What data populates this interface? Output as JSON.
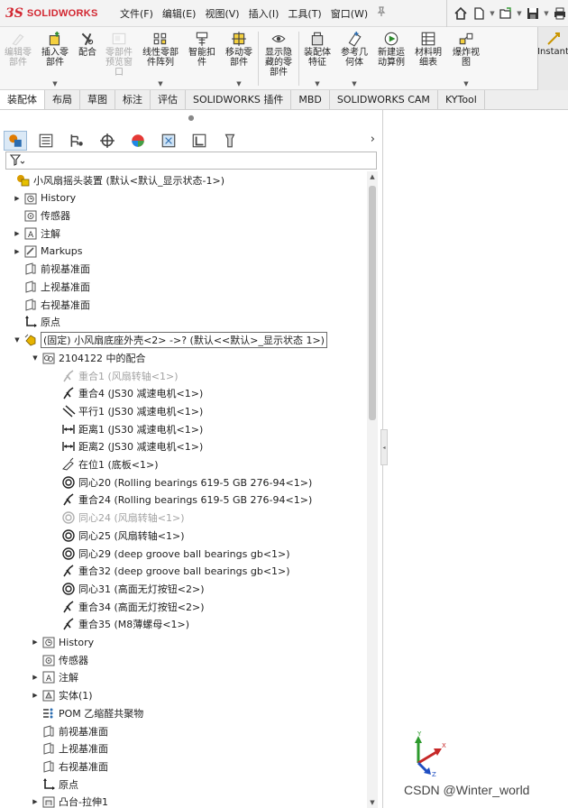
{
  "app": {
    "logo_mark": "3S",
    "logo_text": "SOLIDWORKS"
  },
  "menu": [
    "文件(F)",
    "编辑(E)",
    "视图(V)",
    "插入(I)",
    "工具(T)",
    "窗口(W)"
  ],
  "quick_access": [
    "home-icon",
    "new-document-icon",
    "open-folder-icon",
    "save-icon",
    "print-icon"
  ],
  "ribbon": {
    "buttons": [
      {
        "label": "编辑零\n部件",
        "icon": "edit-component-icon",
        "disabled": true
      },
      {
        "label": "插入零\n部件",
        "icon": "insert-component-icon",
        "disabled": false,
        "dropdown": true
      },
      {
        "label": "配合",
        "icon": "mate-icon",
        "disabled": false
      },
      {
        "label": "零部件\n预览窗\n口",
        "icon": "preview-window-icon",
        "disabled": true
      },
      {
        "label": "线性零部\n件阵列",
        "icon": "linear-pattern-icon",
        "disabled": false,
        "dropdown": true
      },
      {
        "label": "智能扣\n件",
        "icon": "smart-fastener-icon",
        "disabled": false
      },
      {
        "label": "移动零\n部件",
        "icon": "move-component-icon",
        "disabled": false,
        "dropdown": true
      },
      {
        "label": "显示隐\n藏的零\n部件",
        "icon": "show-hidden-icon",
        "disabled": false
      },
      {
        "label": "装配体\n特征",
        "icon": "assembly-feature-icon",
        "disabled": false,
        "dropdown": true
      },
      {
        "label": "参考几\n何体",
        "icon": "reference-geometry-icon",
        "disabled": false,
        "dropdown": true
      },
      {
        "label": "新建运\n动算例",
        "icon": "motion-study-icon",
        "disabled": false
      },
      {
        "label": "材料明\n细表",
        "icon": "bom-icon",
        "disabled": false
      },
      {
        "label": "爆炸视\n图",
        "icon": "exploded-view-icon",
        "disabled": false,
        "dropdown": true
      }
    ],
    "instant": "Instant"
  },
  "tabs": [
    "装配体",
    "布局",
    "草图",
    "标注",
    "评估",
    "SOLIDWORKS 插件",
    "MBD",
    "SOLIDWORKS CAM",
    "KYTool"
  ],
  "fm_tabs": [
    "feature-manager-icon",
    "property-manager-icon",
    "configuration-manager-icon",
    "dimxpert-icon",
    "display-manager-icon",
    "cam-feature-icon",
    "cam-operation-icon",
    "cam-tool-icon"
  ],
  "tree": [
    {
      "level": 0,
      "expander": "",
      "icon": "assembly-icon",
      "text": "小风扇摇头装置  (默认<默认_显示状态-1>)"
    },
    {
      "level": 1,
      "expander": "▶",
      "icon": "history-icon",
      "text": "History"
    },
    {
      "level": 1,
      "expander": "",
      "icon": "sensor-icon",
      "text": "传感器"
    },
    {
      "level": 1,
      "expander": "▶",
      "icon": "annotation-icon",
      "text": "注解"
    },
    {
      "level": 1,
      "expander": "▶",
      "icon": "markups-icon",
      "text": "Markups"
    },
    {
      "level": 1,
      "expander": "",
      "icon": "plane-icon",
      "text": "前视基准面"
    },
    {
      "level": 1,
      "expander": "",
      "icon": "plane-icon",
      "text": "上视基准面"
    },
    {
      "level": 1,
      "expander": "",
      "icon": "plane-icon",
      "text": "右视基准面"
    },
    {
      "level": 1,
      "expander": "",
      "icon": "origin-icon",
      "text": "原点"
    },
    {
      "level": 1,
      "expander": "▼",
      "icon": "part-icon",
      "text": "(固定) 小风扇底座外壳<2> ->? (默认<<默认>_显示状态 1>)",
      "selected": true
    },
    {
      "level": 2,
      "expander": "▼",
      "icon": "mates-folder-icon",
      "text": "2104122 中的配合"
    },
    {
      "level": 3,
      "expander": "",
      "icon": "coincident-mate-icon",
      "text": "重合1 (风扇转轴<1>)",
      "grey": true
    },
    {
      "level": 3,
      "expander": "",
      "icon": "coincident-mate-icon",
      "text": "重合4 (JS30 减速电机<1>)"
    },
    {
      "level": 3,
      "expander": "",
      "icon": "parallel-mate-icon",
      "text": "平行1 (JS30 减速电机<1>)"
    },
    {
      "level": 3,
      "expander": "",
      "icon": "distance-mate-icon",
      "text": "距离1 (JS30 减速电机<1>)"
    },
    {
      "level": 3,
      "expander": "",
      "icon": "distance-mate-icon",
      "text": "距离2 (JS30 减速电机<1>)"
    },
    {
      "level": 3,
      "expander": "",
      "icon": "lock-mate-icon",
      "text": "在位1 (底板<1>)"
    },
    {
      "level": 3,
      "expander": "",
      "icon": "concentric-mate-icon",
      "text": "同心20 (Rolling bearings 619-5 GB 276-94<1>)"
    },
    {
      "level": 3,
      "expander": "",
      "icon": "coincident-mate-icon",
      "text": "重合24 (Rolling bearings 619-5 GB 276-94<1>)"
    },
    {
      "level": 3,
      "expander": "",
      "icon": "concentric-mate-icon",
      "text": "同心24 (风扇转轴<1>)",
      "grey": true
    },
    {
      "level": 3,
      "expander": "",
      "icon": "concentric-mate-icon",
      "text": "同心25 (风扇转轴<1>)"
    },
    {
      "level": 3,
      "expander": "",
      "icon": "concentric-mate-icon",
      "text": "同心29 (deep groove ball bearings gb<1>)"
    },
    {
      "level": 3,
      "expander": "",
      "icon": "coincident-mate-icon",
      "text": "重合32 (deep groove ball bearings gb<1>)"
    },
    {
      "level": 3,
      "expander": "",
      "icon": "concentric-mate-icon",
      "text": "同心31 (高面无灯按钮<2>)"
    },
    {
      "level": 3,
      "expander": "",
      "icon": "coincident-mate-icon",
      "text": "重合34 (高面无灯按钮<2>)"
    },
    {
      "level": 3,
      "expander": "",
      "icon": "coincident-mate-icon",
      "text": "重合35 (M8薄螺母<1>)"
    },
    {
      "level": 2,
      "expander": "▶",
      "icon": "history-icon",
      "text": "History"
    },
    {
      "level": 2,
      "expander": "",
      "icon": "sensor-icon",
      "text": "传感器"
    },
    {
      "level": 2,
      "expander": "▶",
      "icon": "annotation-icon",
      "text": "注解"
    },
    {
      "level": 2,
      "expander": "▶",
      "icon": "solid-bodies-icon",
      "text": "实体(1)"
    },
    {
      "level": 2,
      "expander": "",
      "icon": "material-icon",
      "text": "POM 乙缩醛共聚物"
    },
    {
      "level": 2,
      "expander": "",
      "icon": "plane-icon",
      "text": "前视基准面"
    },
    {
      "level": 2,
      "expander": "",
      "icon": "plane-icon",
      "text": "上视基准面"
    },
    {
      "level": 2,
      "expander": "",
      "icon": "plane-icon",
      "text": "右视基准面"
    },
    {
      "level": 2,
      "expander": "",
      "icon": "origin-icon",
      "text": "原点"
    },
    {
      "level": 2,
      "expander": "▶",
      "icon": "boss-extrude-icon",
      "text": "凸台-拉伸1"
    }
  ],
  "watermark": "CSDN @Winter_world",
  "colors": {
    "brand": "#d22630",
    "selection": "#6c6c6c",
    "mate_icon": "#1e1e1e",
    "accent_blue": "#2b6cb0"
  }
}
